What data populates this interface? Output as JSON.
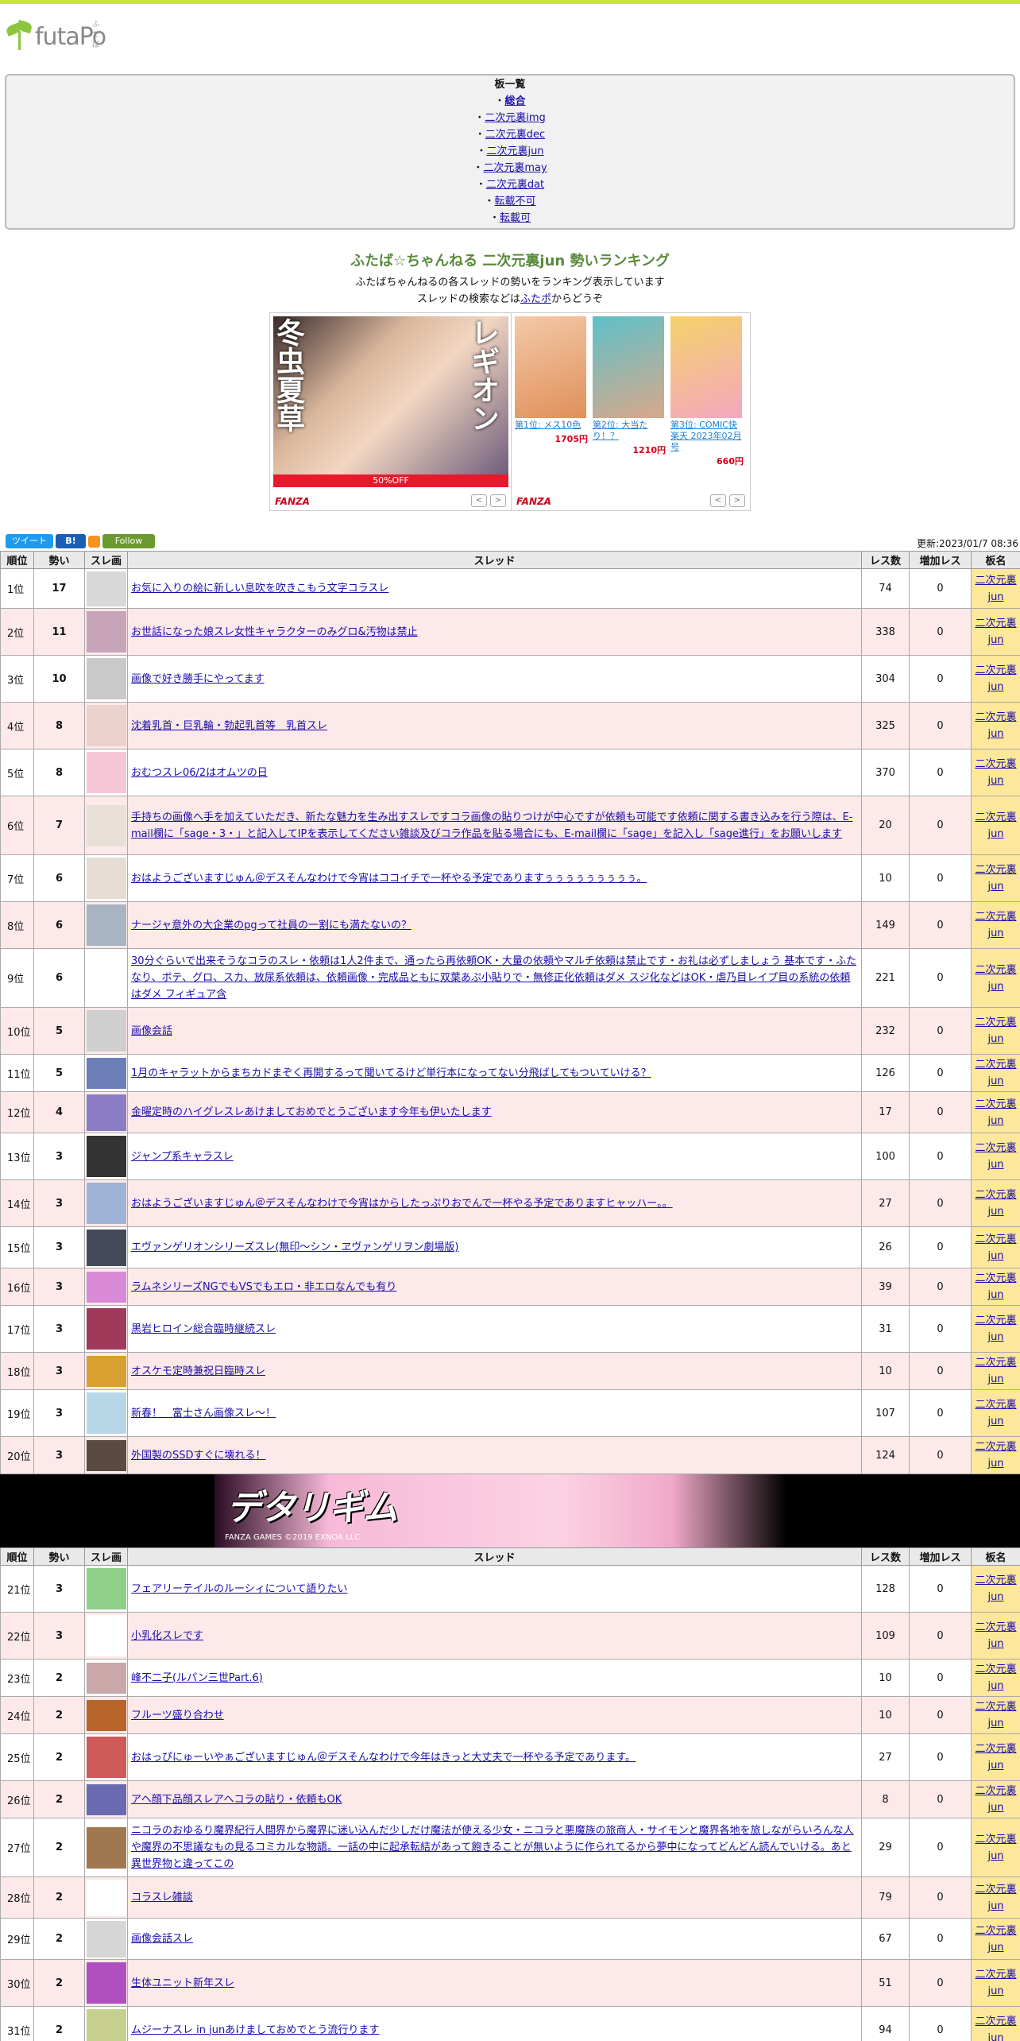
{
  "site": {
    "logo": "futaPo",
    "logo_sup": "ふたぽ"
  },
  "boards": {
    "title": "板一覧",
    "items": [
      {
        "label": "総合",
        "selected": true
      },
      {
        "label": "二次元裏img"
      },
      {
        "label": "二次元裏dec"
      },
      {
        "label": "二次元裏jun"
      },
      {
        "label": "二次元裏may"
      },
      {
        "label": "二次元裏dat"
      },
      {
        "label": "転載不可"
      },
      {
        "label": "転載可"
      }
    ]
  },
  "ranking": {
    "title": "ふたば☆ちゃんねる 二次元裏jun 勢いランキング",
    "sub1": "ふたばちゃんねるの各スレッドの勢いをランキング表示しています",
    "sub2_pre": "スレッドの検索などは",
    "sub2_link": "ふたポ",
    "sub2_post": "からどうぞ"
  },
  "ads": {
    "left": {
      "v1": "冬虫夏草",
      "v2": "レギオン",
      "off": "50%OFF",
      "brand": "FANZA"
    },
    "right": {
      "brand": "FANZA",
      "products": [
        {
          "label": "第1位: メス10色",
          "price": "1705円"
        },
        {
          "label": "第2位: 大当たり！？",
          "price": "1210円"
        },
        {
          "label": "第3位: COMIC快楽天 2023年02月号",
          "price": "660円"
        }
      ]
    },
    "nav_prev": "<",
    "nav_next": ">"
  },
  "tools": {
    "tweet": "ツイート",
    "hatena": "B!",
    "follow": "Follow",
    "updated": "更新:2023/01/7 08:36"
  },
  "table": {
    "headers": {
      "rank": "順位",
      "ikioi": "勢い",
      "img": "スレ画",
      "thread": "スレッド",
      "res": "レス数",
      "inc": "増加レス",
      "board": "板名"
    },
    "board_l1": "二次元裏",
    "board_l2": "jun",
    "rows1": [
      {
        "rank": "1位",
        "ikioi": "17",
        "title": "お気に入りの絵に新しい息吹を吹きこもう文字コラスレ",
        "res": "74",
        "inc": "0",
        "thumb": "#d8d8d8"
      },
      {
        "rank": "2位",
        "ikioi": "11",
        "title": "お世話になった娘スレ女性キャラクターのみグロ&汚物は禁止",
        "res": "338",
        "inc": "0",
        "thumb": "#c7a4b8"
      },
      {
        "rank": "3位",
        "ikioi": "10",
        "title": "画像で好き勝手にやってます",
        "res": "304",
        "inc": "0",
        "thumb": "#c9c9c9"
      },
      {
        "rank": "4位",
        "ikioi": "8",
        "title": "沈着乳首・巨乳輪・勃起乳首等　乳首スレ",
        "res": "325",
        "inc": "0",
        "thumb": "#ecd2cc"
      },
      {
        "rank": "5位",
        "ikioi": "8",
        "title": "おむつスレ06/2はオムツの日",
        "res": "370",
        "inc": "0",
        "thumb": "#f4c6d6"
      },
      {
        "rank": "6位",
        "ikioi": "7",
        "title": "手持ちの画像へ手を加えていただき、新たな魅力を生み出すスレですコラ画像の貼りつけが中心ですが依頼も可能です依頼に関する書き込みを行う際は、E-mail欄に「sage・3・」と記入してIPを表示してください雑談及びコラ作品を貼る場合にも、E-mail欄に「sage」を記入し「sage進行」をお願いします",
        "res": "20",
        "inc": "0",
        "thumb": "#e8e0d8"
      },
      {
        "rank": "7位",
        "ikioi": "6",
        "title": "おはようございますじゅん＠デスそんなわけで今宵はココイチで一杯やる予定でありますぅぅぅぅぅぅぅぅぅ。",
        "res": "10",
        "inc": "0",
        "thumb": "#e6dcd4"
      },
      {
        "rank": "8位",
        "ikioi": "6",
        "title": "ナージャ意外の大企業のpgって社員の一割にも満たないの？",
        "res": "149",
        "inc": "0",
        "thumb": "#a9b4c2"
      },
      {
        "rank": "9位",
        "ikioi": "6",
        "title": "30分ぐらいで出来そうなコラのスレ・依頼は1人2件まで、通ったら再依頼OK・大量の依頼やマルチ依頼は禁止です・お礼は必ずしましょう 基本です・ふたなり、ボテ、グロ、スカ、放尿系依頼は、依頼画像・完成品ともに双葉あぷ小貼りで・無修正化依頼はダメ スジ化などはOK・虐乃目レイプ目の系統の依頼はダメ フィギュア含",
        "res": "221",
        "inc": "0",
        "thumb": "#ffffff"
      },
      {
        "rank": "10位",
        "ikioi": "5",
        "title": "画像会話",
        "res": "232",
        "inc": "0",
        "thumb": "#cfcfcf"
      },
      {
        "rank": "11位",
        "ikioi": "5",
        "title": "1月のキャラットからまちカドまぞく再開するって聞いてるけど単行本になってない分飛ばしてもついていける？",
        "res": "126",
        "inc": "0",
        "thumb": "#6c7fb8"
      },
      {
        "rank": "12位",
        "ikioi": "4",
        "title": "金曜定時のハイグレスレあけましておめでとうございます今年も伊いたします",
        "res": "17",
        "inc": "0",
        "thumb": "#8a7cc4"
      },
      {
        "rank": "13位",
        "ikioi": "3",
        "title": "ジャンプ系キャラスレ",
        "res": "100",
        "inc": "0",
        "thumb": "#333333"
      },
      {
        "rank": "14位",
        "ikioi": "3",
        "title": "おはようございますじゅん＠デスそんなわけで今宵はからしたっぷりおでんで一杯やる予定でありますヒャッハー。。",
        "res": "27",
        "inc": "0",
        "thumb": "#9fb3d6"
      },
      {
        "rank": "15位",
        "ikioi": "3",
        "title": "エヴァンゲリオンシリーズスレ(無印～シン・ヱヴァンゲリヲン劇場版)",
        "res": "26",
        "inc": "0",
        "thumb": "#444a5a"
      },
      {
        "rank": "16位",
        "ikioi": "3",
        "title": "ラムネシリーズNGでもVSでもエロ・非エロなんでも有り",
        "res": "39",
        "inc": "0",
        "thumb": "#d98ad6"
      },
      {
        "rank": "17位",
        "ikioi": "3",
        "title": "黒岩ヒロイン総合臨時継続スレ",
        "res": "31",
        "inc": "0",
        "thumb": "#a03a5a"
      },
      {
        "rank": "18位",
        "ikioi": "3",
        "title": "オスケモ定時兼祝日臨時スレ",
        "res": "10",
        "inc": "0",
        "thumb": "#d8a030"
      },
      {
        "rank": "19位",
        "ikioi": "3",
        "title": "新春！　富士さん画像スレ～！",
        "res": "107",
        "inc": "0",
        "thumb": "#b7d6e8"
      },
      {
        "rank": "20位",
        "ikioi": "3",
        "title": "外国製のSSDすぐに壊れる！",
        "res": "124",
        "inc": "0",
        "thumb": "#5a4a40"
      }
    ],
    "rows2": [
      {
        "rank": "21位",
        "ikioi": "3",
        "title": "フェアリーテイルのルーシィについて語りたい",
        "res": "128",
        "inc": "0",
        "thumb": "#8fcf8a"
      },
      {
        "rank": "22位",
        "ikioi": "3",
        "title": "小乳化スレです",
        "res": "109",
        "inc": "0",
        "thumb": "#ffffff"
      },
      {
        "rank": "23位",
        "ikioi": "2",
        "title": "峰不二子(ルパン三世Part.6)",
        "res": "10",
        "inc": "0",
        "thumb": "#c8a8a8"
      },
      {
        "rank": "24位",
        "ikioi": "2",
        "title": "フルーツ盛り合わせ",
        "res": "10",
        "inc": "0",
        "thumb": "#b8652a"
      },
      {
        "rank": "25位",
        "ikioi": "2",
        "title": "おはっぴにゅーいやぁございますじゅん＠デスそんなわけで今年はきっと大丈夫で一杯やる予定であります。",
        "res": "27",
        "inc": "0",
        "thumb": "#d05a5a"
      },
      {
        "rank": "26位",
        "ikioi": "2",
        "title": "アヘ顔下品顔スレアヘコラの貼り・依頼もOK",
        "res": "8",
        "inc": "0",
        "thumb": "#6a6ab0"
      },
      {
        "rank": "27位",
        "ikioi": "2",
        "title": "ニコラのおゆるり魔界紀行人間界から魔界に迷い込んだ少しだけ魔法が使える少女・ニコラと悪魔族の旅商人・サイモンと魔界各地を旅しながらいろんな人や魔界の不思議なもの見るコミカルな物語。一話の中に起承転結があって飽きることが無いように作られてるから夢中になってどんどん読んでいける。あと異世界物と違ってこの",
        "res": "29",
        "inc": "0",
        "thumb": "#a07850"
      },
      {
        "rank": "28位",
        "ikioi": "2",
        "title": "コラスレ雑談",
        "res": "79",
        "inc": "0",
        "thumb": "#ffffff"
      },
      {
        "rank": "29位",
        "ikioi": "2",
        "title": "画像会話スレ",
        "res": "67",
        "inc": "0",
        "thumb": "#d6d6d6"
      },
      {
        "rank": "30位",
        "ikioi": "2",
        "title": "生体ユニット新年スレ",
        "res": "51",
        "inc": "0",
        "thumb": "#b050c0"
      },
      {
        "rank": "31位",
        "ikioi": "2",
        "title": "ムジーナスレ in junあけましておめでとう流行ります",
        "res": "94",
        "inc": "0",
        "thumb": "#c8d090"
      }
    ]
  },
  "banner": {
    "title": "デタリギム",
    "sub": "FANZA GAMES ©2019 EXNOA LLC"
  }
}
